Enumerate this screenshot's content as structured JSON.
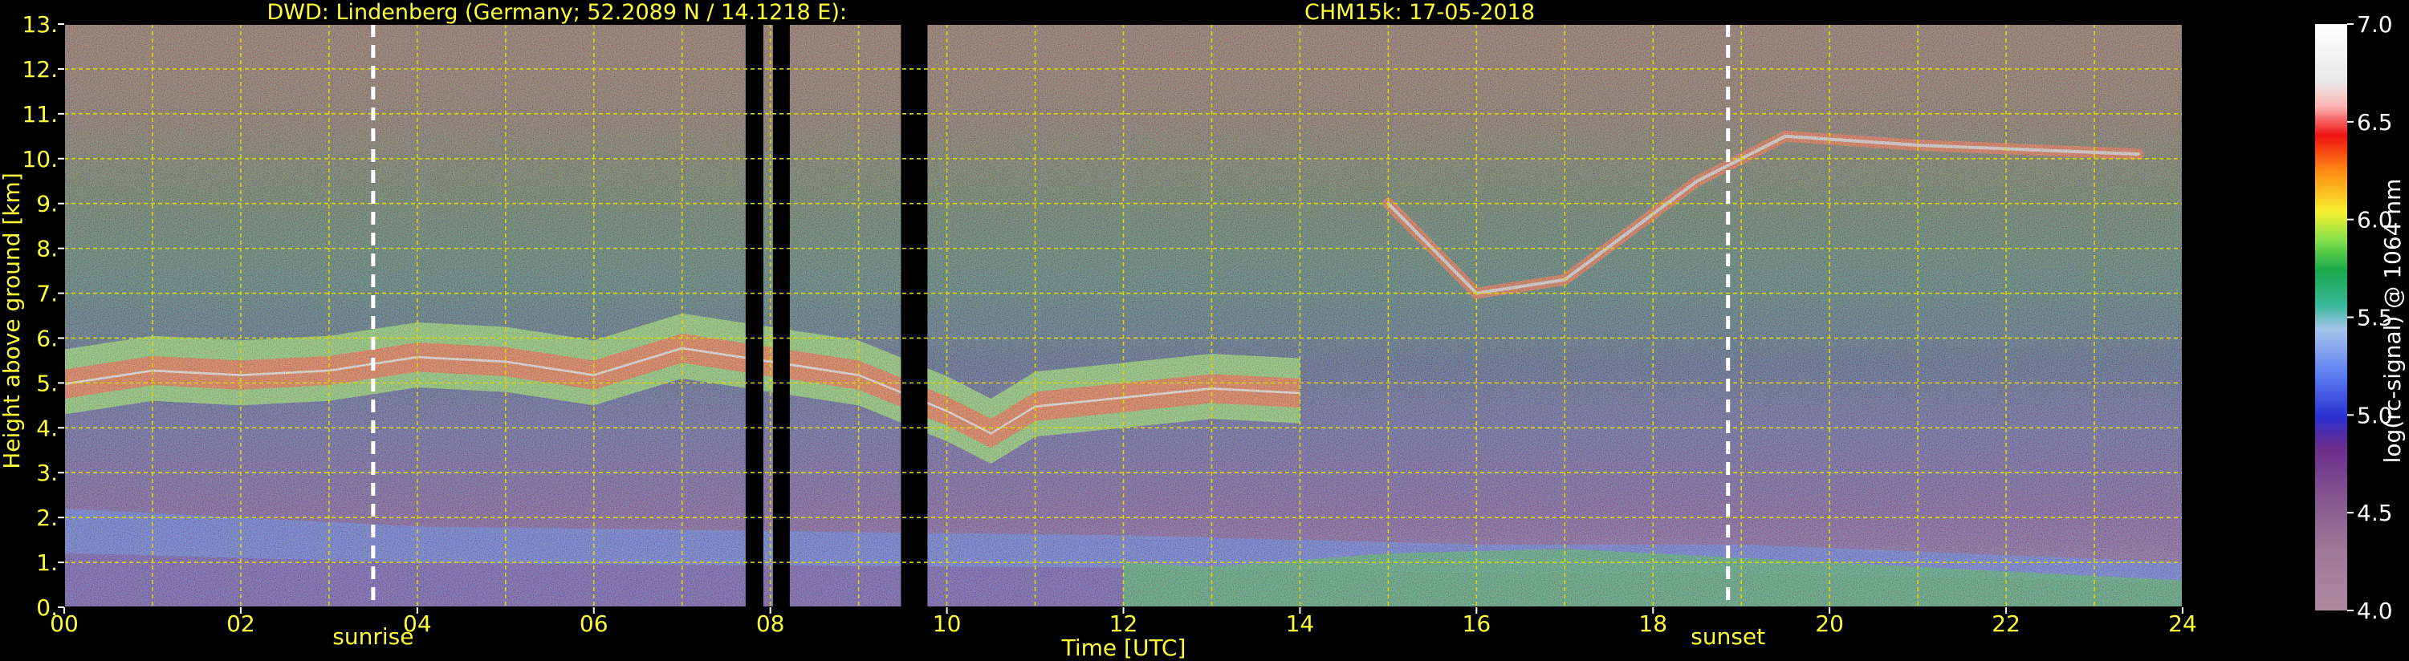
{
  "chart_data": {
    "type": "heatmap",
    "title_left": "DWD: Lindenberg (Germany; 52.2089 N / 14.1218 E):",
    "title_right": "CHM15k: 17-05-2018",
    "xlabel": "Time [UTC]",
    "ylabel": "Height above ground [km]",
    "colorbar_label": "log(rc-signal) @ 1064 nm",
    "xlim": [
      0,
      24
    ],
    "ylim": [
      0,
      13
    ],
    "clim": [
      4.0,
      7.0
    ],
    "x_ticks": [
      "00",
      "02",
      "04",
      "06",
      "08",
      "10",
      "12",
      "14",
      "16",
      "18",
      "20",
      "22",
      "24"
    ],
    "y_ticks": [
      "0.",
      "1.",
      "2.",
      "3.",
      "4.",
      "5.",
      "6.",
      "7.",
      "8.",
      "9.",
      "10.",
      "11.",
      "12.",
      "13."
    ],
    "colorbar_ticks": [
      "4.0",
      "4.5",
      "5.0",
      "5.5",
      "6.0",
      "6.5",
      "7.0"
    ],
    "grid": true,
    "markers": [
      {
        "label": "sunrise",
        "time": 3.5
      },
      {
        "label": "sunset",
        "time": 18.85
      }
    ],
    "data_gaps": [
      [
        7.72,
        7.92
      ],
      [
        8.03,
        8.22
      ],
      [
        9.48,
        9.78
      ]
    ],
    "layers": {
      "aerosol_layer_top_km": [
        [
          0.0,
          5.2
        ],
        [
          1.0,
          5.5
        ],
        [
          2.0,
          5.4
        ],
        [
          3.0,
          5.5
        ],
        [
          4.0,
          5.8
        ],
        [
          5.0,
          5.7
        ],
        [
          6.0,
          5.4
        ],
        [
          7.0,
          6.0
        ],
        [
          8.0,
          5.7
        ],
        [
          9.0,
          5.4
        ],
        [
          10.0,
          4.6
        ],
        [
          10.5,
          4.1
        ],
        [
          11.0,
          4.7
        ],
        [
          12.0,
          4.9
        ],
        [
          13.0,
          5.1
        ],
        [
          14.0,
          5.0
        ]
      ],
      "boundary_layer_km": [
        [
          0.0,
          2.2
        ],
        [
          4.0,
          1.8
        ],
        [
          8.0,
          1.7
        ],
        [
          12.0,
          1.6
        ],
        [
          16.0,
          1.4
        ],
        [
          19.0,
          1.4
        ],
        [
          24.0,
          1.0
        ]
      ],
      "cirrus_km": [
        [
          15.0,
          9.0
        ],
        [
          16.0,
          7.0
        ],
        [
          17.0,
          7.3
        ],
        [
          18.5,
          9.5
        ],
        [
          19.5,
          10.5
        ],
        [
          21.0,
          10.3
        ],
        [
          23.5,
          10.1
        ]
      ]
    },
    "colormap": [
      "#b08aa0",
      "#a07898",
      "#8a5f90",
      "#6a2c8c",
      "#4a1a9a",
      "#2a30d0",
      "#3a5cf0",
      "#6a8ef2",
      "#90b4f0",
      "#a6c4ec",
      "#3ab89a",
      "#1aa84a",
      "#2ec845",
      "#7ee04a",
      "#c8ee3a",
      "#f8f030",
      "#ffc41c",
      "#ff8a14",
      "#ff4a12",
      "#ee1010",
      "#ffb4b4",
      "#e8e8e8",
      "#ffffff"
    ]
  }
}
